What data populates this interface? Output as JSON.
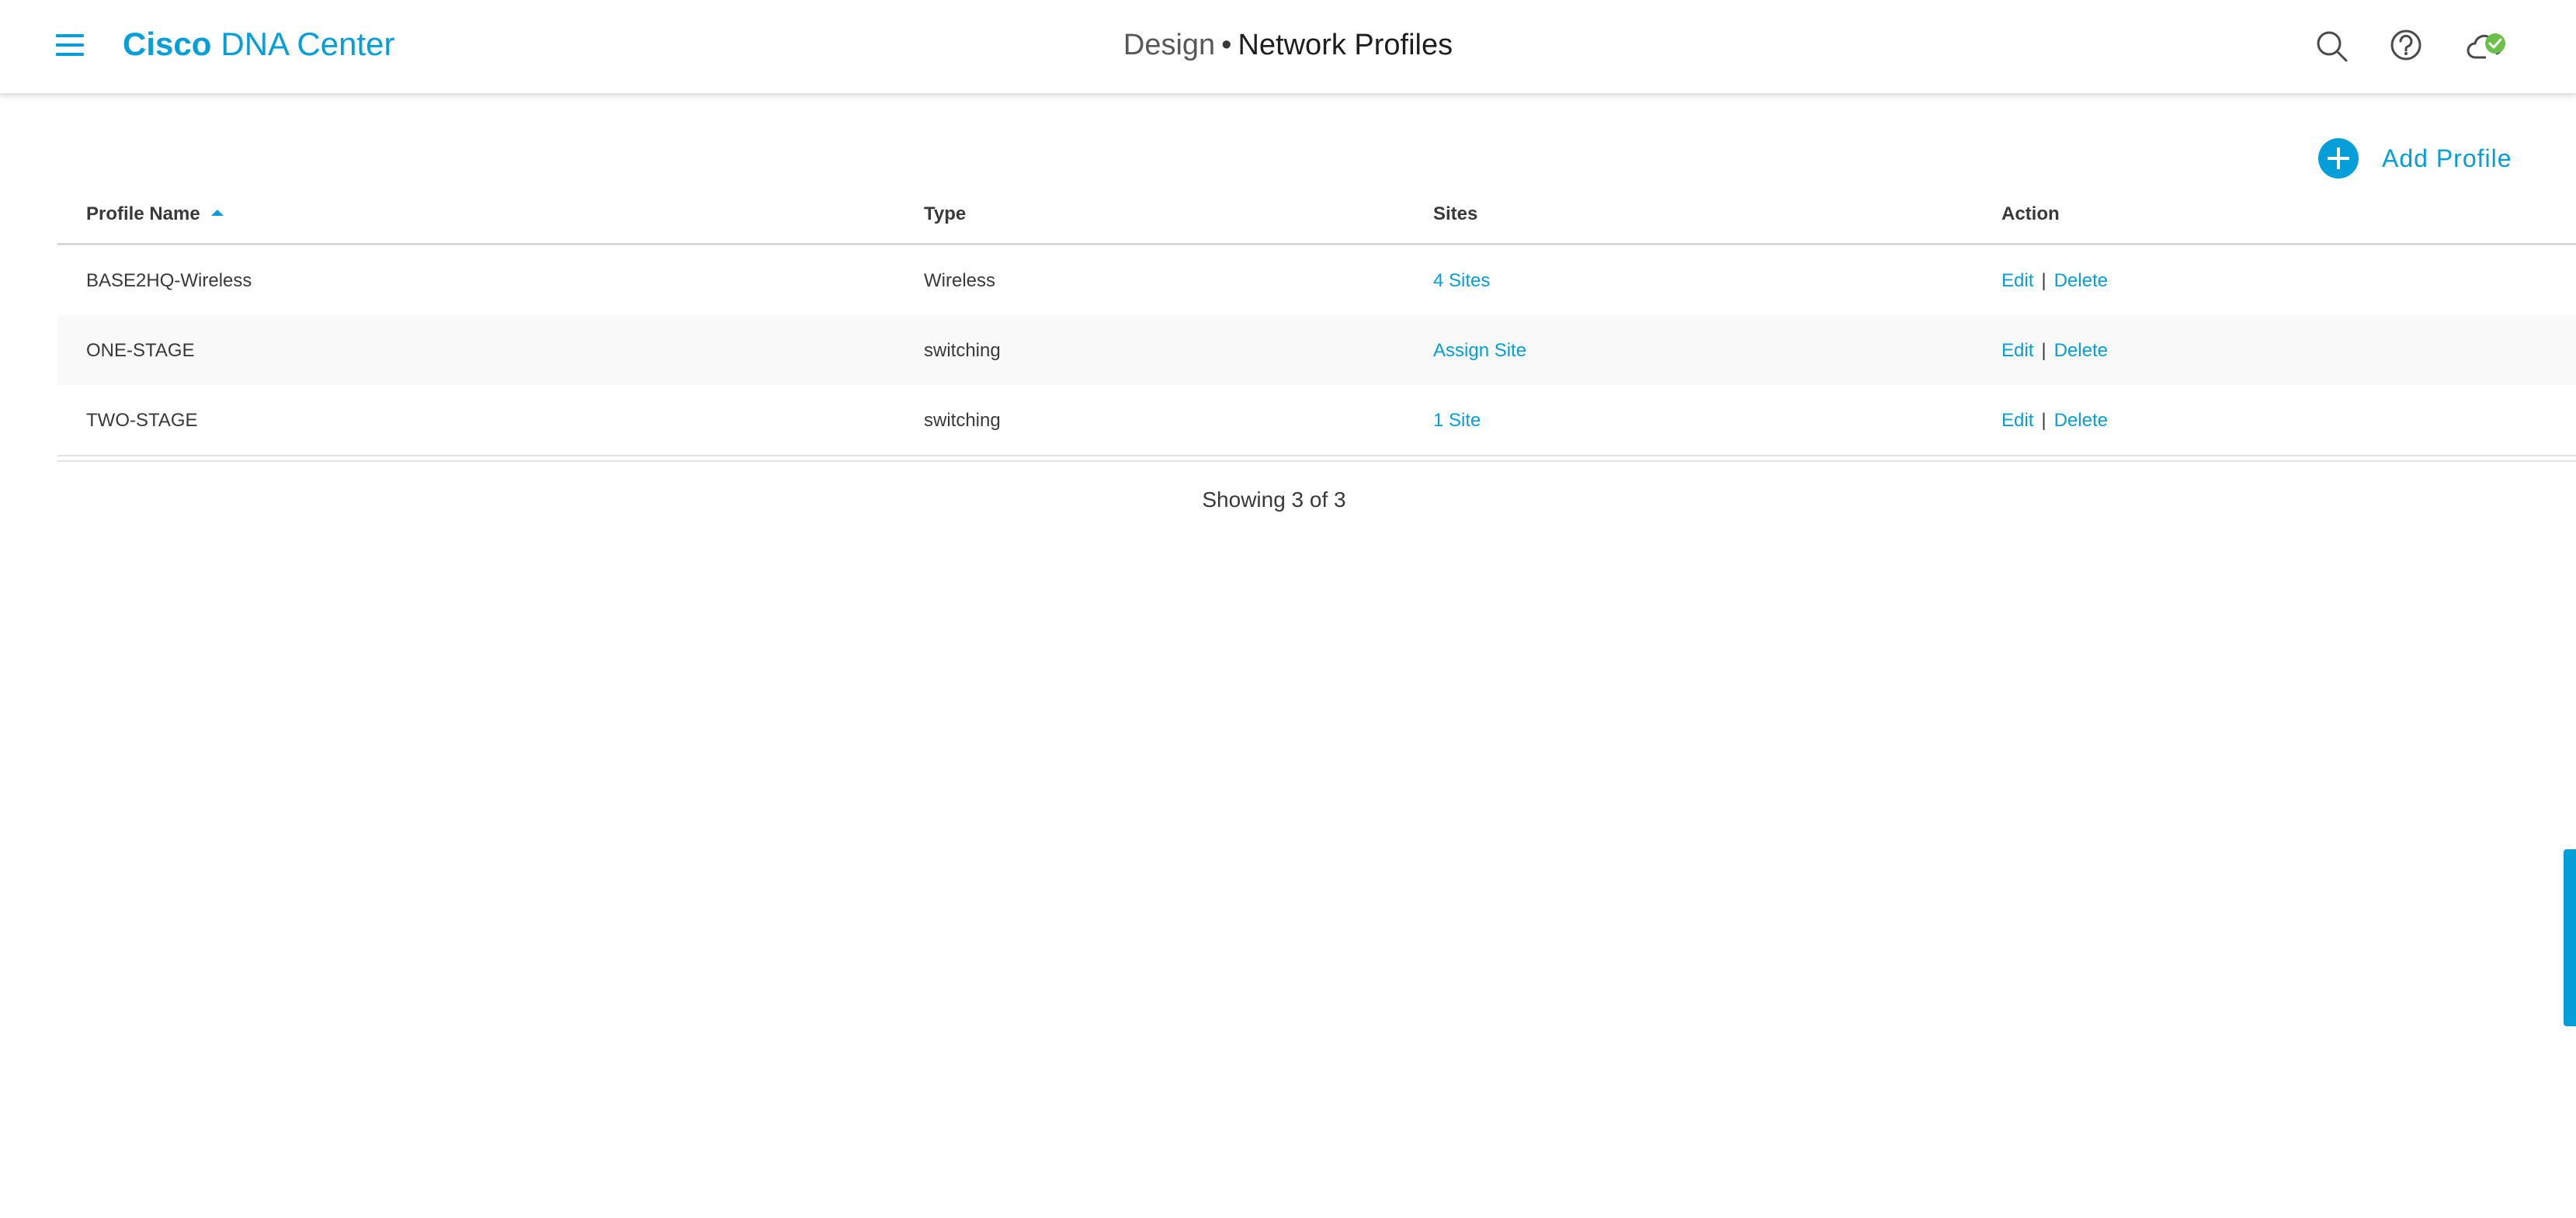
{
  "header": {
    "menu_icon": "hamburger-menu-icon",
    "brand_bold": "Cisco",
    "brand_rest": "DNA Center",
    "section": "Design",
    "separator": "•",
    "page_title": "Network Profiles",
    "icons": [
      "search-icon",
      "help-icon",
      "cloud-status-icon"
    ]
  },
  "toolbar": {
    "add_label": "Add Profile",
    "add_icon": "plus-circle-icon"
  },
  "table": {
    "columns": [
      "Profile Name",
      "Type",
      "Sites",
      "Action"
    ],
    "sort": {
      "column": "Profile Name",
      "direction": "ascending"
    },
    "rows": [
      {
        "name": "BASE2HQ-Wireless",
        "type": "Wireless",
        "sites": "4 Sites",
        "edit": "Edit",
        "sep": "|",
        "delete": "Delete"
      },
      {
        "name": "ONE-STAGE",
        "type": "switching",
        "sites": "Assign Site",
        "edit": "Edit",
        "sep": "|",
        "delete": "Delete"
      },
      {
        "name": "TWO-STAGE",
        "type": "switching",
        "sites": "1 Site",
        "edit": "Edit",
        "sep": "|",
        "delete": "Delete"
      }
    ],
    "count_text": "Showing 3 of 3"
  },
  "colors": {
    "accent": "#049fd9",
    "status_ok": "#6cc04a",
    "text": "#39393b"
  }
}
